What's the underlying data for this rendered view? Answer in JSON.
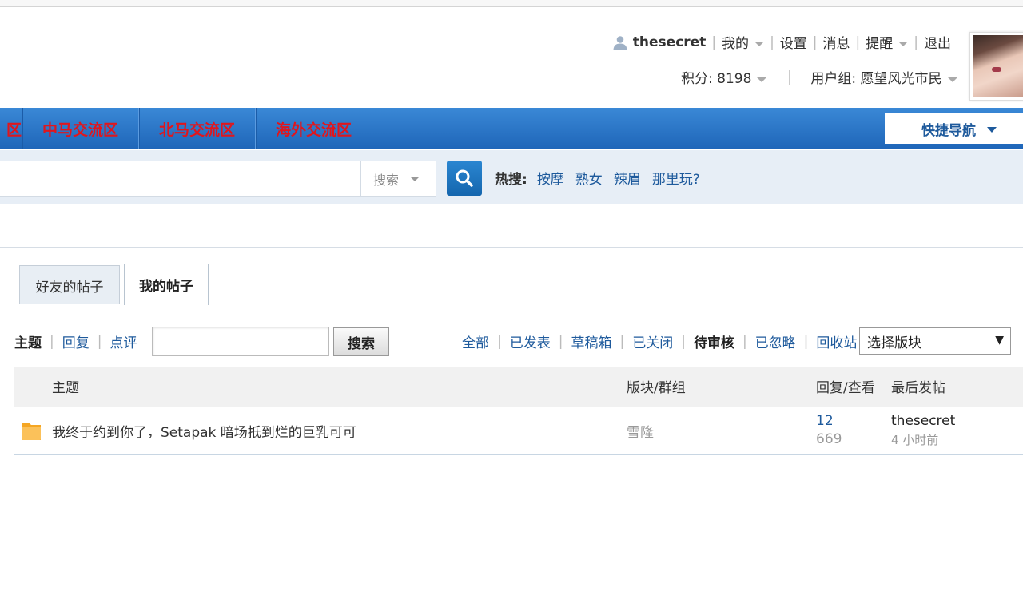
{
  "user": {
    "username": "thesecret",
    "menu": [
      {
        "label": "我的",
        "has_dropdown": true
      },
      {
        "label": "设置",
        "has_dropdown": false
      },
      {
        "label": "消息",
        "has_dropdown": false
      },
      {
        "label": "提醒",
        "has_dropdown": true
      },
      {
        "label": "退出",
        "has_dropdown": false
      }
    ],
    "credits_label": "积分: 8198",
    "group_label": "用户组: 愿望风光市民"
  },
  "nav": {
    "partial_first": "区",
    "items": [
      "中马交流区",
      "北马交流区",
      "海外交流区"
    ],
    "quick_nav": "快捷导航"
  },
  "search": {
    "input_value": "",
    "scope": "搜索",
    "hot_label": "热搜:",
    "hot_terms": [
      "按摩",
      "熟女",
      "辣眉",
      "那里玩?"
    ]
  },
  "tabs": {
    "friends": "好友的帖子",
    "mine": "我的帖子"
  },
  "filter": {
    "types": {
      "topic": "主题",
      "reply": "回复",
      "comment": "点评"
    },
    "keyword_value": "",
    "search_btn": "搜索",
    "status": [
      "全部",
      "已发表",
      "草稿箱",
      "已关闭",
      "待审核",
      "已忽略",
      "回收站"
    ],
    "status_current": "待审核",
    "forum_select": "选择版块"
  },
  "table": {
    "headers": {
      "topic": "主题",
      "forum": "版块/群组",
      "stats": "回复/查看",
      "last": "最后发帖"
    },
    "rows": [
      {
        "title": "我终于约到你了，Setapak 暗场抵到烂的巨乳可可",
        "forum": "雪隆",
        "replies": "12",
        "views": "669",
        "last_user": "thesecret",
        "last_time": "4 小时前"
      }
    ]
  },
  "colors": {
    "nav_blue": "#2a78cc",
    "nav_text_red": "#e0161d",
    "link_blue": "#1e5a9c",
    "folder_orange": "#f7b23b"
  }
}
